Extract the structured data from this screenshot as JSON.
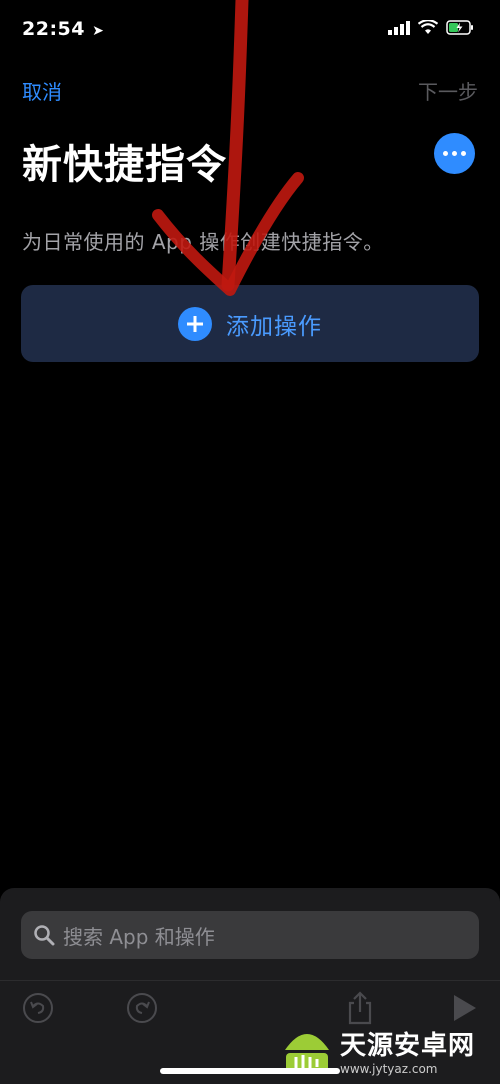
{
  "status": {
    "time": "22:54"
  },
  "nav": {
    "cancel": "取消",
    "next": "下一步"
  },
  "page": {
    "title": "新快捷指令",
    "subtitle": "为日常使用的 App 操作创建快捷指令。",
    "add_action": "添加操作"
  },
  "search": {
    "placeholder": "搜索 App 和操作"
  },
  "toolbar": {
    "icons": [
      "undo-icon",
      "redo-icon",
      "share-icon",
      "play-icon"
    ]
  },
  "watermark": {
    "title": "天源安卓网",
    "url": "www.jytyaz.com"
  },
  "colors": {
    "accent": "#2f8cff",
    "background": "#000000",
    "card": "#1e2a44",
    "annotation": "#c0180f"
  }
}
